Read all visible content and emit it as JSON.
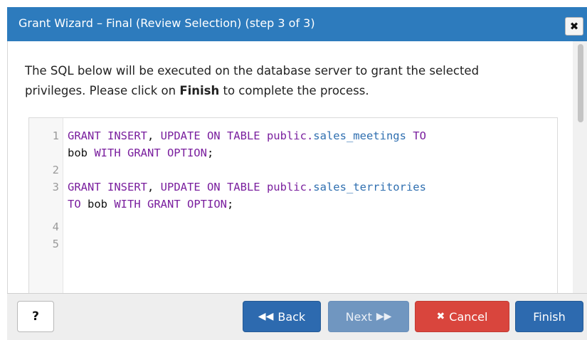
{
  "dialog": {
    "title": "Grant Wizard – Final (Review Selection) (step 3 of 3)",
    "close_glyph": "✖"
  },
  "intro": {
    "text_before": "The SQL below will be executed on the database server to grant the selected privileges. Please click on ",
    "bold": "Finish",
    "text_after": " to complete the process."
  },
  "sql": {
    "line_numbers": [
      "1",
      "",
      "2",
      "3",
      "",
      "4",
      "5"
    ],
    "l1_kw1": "GRANT INSERT",
    "l1_p1": ", ",
    "l1_kw2": "UPDATE ON TABLE public.",
    "l1_tbl": "sales_meetings",
    "l1_kw3": " TO",
    "l1b_p": "bob ",
    "l1b_kw": "WITH GRANT OPTION",
    "l1b_end": ";",
    "l3_kw1": "GRANT INSERT",
    "l3_p1": ", ",
    "l3_kw2": "UPDATE ON TABLE public.",
    "l3_tbl": "sales_territories",
    "l3b_kw1": "TO",
    "l3b_p": " bob ",
    "l3b_kw2": "WITH GRANT OPTION",
    "l3b_end": ";"
  },
  "footer": {
    "help_label": "?",
    "back_icon": "◀◀",
    "back_label": "Back",
    "next_label": "Next",
    "next_icon": "▶▶",
    "cancel_icon": "✖",
    "cancel_label": "Cancel",
    "finish_label": "Finish"
  },
  "colors": {
    "title_bar": "#2d7bbd",
    "keyword": "#7a1f9e",
    "table_name": "#2f6fb0",
    "primary_button": "#2d6aaf",
    "cancel_button": "#d9453d"
  }
}
